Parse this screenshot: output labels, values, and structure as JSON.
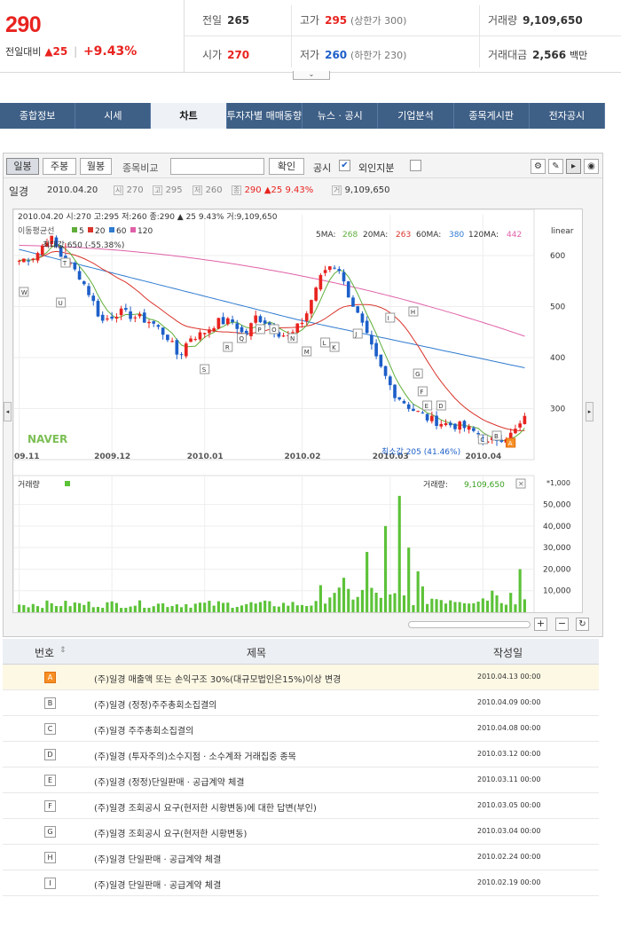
{
  "quote": {
    "price": "290",
    "change_label": "전일대비",
    "change_arrow": "▲",
    "change_value": "25",
    "change_pct": "+9.43%",
    "prev_close_label": "전일",
    "prev_close": "265",
    "high_label": "고가",
    "high": "295",
    "high_limit": "(상한가 300)",
    "volume_label": "거래량",
    "volume": "9,109,650",
    "open_label": "시가",
    "open": "270",
    "low_label": "저가",
    "low": "260",
    "low_limit": "(하한가 230)",
    "amount_label": "거래대금",
    "amount": "2,566",
    "amount_unit": "백만",
    "toggle_glyph": "⌄"
  },
  "nav": {
    "tabs": [
      "종합정보",
      "시세",
      "차트",
      "투자자별 매매동향",
      "뉴스 · 공시",
      "기업분석",
      "종목게시판",
      "전자공시"
    ],
    "active": 2
  },
  "toolbar": {
    "periods": [
      "일봉",
      "주봉",
      "월봉"
    ],
    "compare_label": "종목비교",
    "compare_placeholder": "",
    "confirm": "확인",
    "notice_label": "공시",
    "foreign_label": "외인지분"
  },
  "infobar": {
    "name": "일경",
    "date": "2010.04.20",
    "open_tag": "시",
    "open": "270",
    "high_tag": "고",
    "high": "295",
    "low_tag": "저",
    "low": "260",
    "close_tag": "종",
    "close": "290",
    "chg": "▲25",
    "pct": "9.43%",
    "vol_tag": "거",
    "vol": "9,109,650"
  },
  "chart": {
    "ohlc_line": "2010.04.20  시:270  고:295  저:260  종:290  ▲   25    9.43%  거:9,109,650",
    "ma_title": "이동평균선",
    "ma_labels": [
      "5",
      "20",
      "60",
      "120"
    ],
    "ma_readout": [
      {
        "name": "5MA:",
        "value": "268"
      },
      {
        "name": "20MA:",
        "value": "263"
      },
      {
        "name": "60MA:",
        "value": "380"
      },
      {
        "name": "120MA:",
        "value": "442"
      }
    ],
    "scale": "linear",
    "max_label": "최대값 650 (-55.38%)",
    "min_label": "최소값 205 (41.46%)",
    "watermark": "NAVER",
    "volume_title": "거래량",
    "volume_readout_label": "거래량:",
    "volume_readout": "9,109,650",
    "volume_unit": "*1,000",
    "colors": {
      "ma5": "#5fae3a",
      "ma20": "#d9342b",
      "ma60": "#2f7bd0",
      "ma120": "#e060a8",
      "up": "#e8231f",
      "down": "#1d5fc9",
      "vol": "#5cc238"
    }
  },
  "chart_data": {
    "type": "candlestick",
    "x_ticks": [
      "09.11",
      "2009.12",
      "2010.01",
      "2010.02",
      "2010.03",
      "2010.04"
    ],
    "price_ticks": [
      600,
      500,
      400,
      300
    ],
    "volume_ticks": [
      "50,000",
      "40,000",
      "30,000",
      "20,000",
      "10,000"
    ],
    "ylim": [
      200,
      680
    ],
    "volume_ylim": [
      0,
      56000
    ],
    "notice_markers": [
      "W",
      "U",
      "T",
      "S",
      "R",
      "Q",
      "P",
      "O",
      "N",
      "M",
      "L",
      "K",
      "J",
      "I",
      "H",
      "G",
      "F",
      "E",
      "D",
      "C",
      "B",
      "A"
    ]
  },
  "notices": {
    "headers": {
      "no": "번호",
      "title": "제목",
      "date": "작성일",
      "sort": "⇕"
    },
    "rows": [
      {
        "mark": "A",
        "title": "(주)일경 매출액 또는 손익구조 30%(대규모법인은15%)이상 변경",
        "date": "2010.04.13 00:00"
      },
      {
        "mark": "B",
        "title": "(주)일경 (정정)주주총회소집결의",
        "date": "2010.04.09 00:00"
      },
      {
        "mark": "C",
        "title": "(주)일경 주주총회소집결의",
        "date": "2010.04.08 00:00"
      },
      {
        "mark": "D",
        "title": "(주)일경 (투자주의)소수지점 · 소수계좌 거래집중 종목",
        "date": "2010.03.12 00:00"
      },
      {
        "mark": "E",
        "title": "(주)일경 (정정)단일판매 · 공급계약 체결",
        "date": "2010.03.11 00:00"
      },
      {
        "mark": "F",
        "title": "(주)일경 조회공시 요구(현저한 시황변동)에 대한 답변(부인)",
        "date": "2010.03.05 00:00"
      },
      {
        "mark": "G",
        "title": "(주)일경 조회공시 요구(현저한 시황변동)",
        "date": "2010.03.04 00:00"
      },
      {
        "mark": "H",
        "title": "(주)일경 단일판매 · 공급계약 체결",
        "date": "2010.02.24 00:00"
      },
      {
        "mark": "I",
        "title": "(주)일경 단일판매 · 공급계약 체결",
        "date": "2010.02.19 00:00"
      }
    ]
  }
}
